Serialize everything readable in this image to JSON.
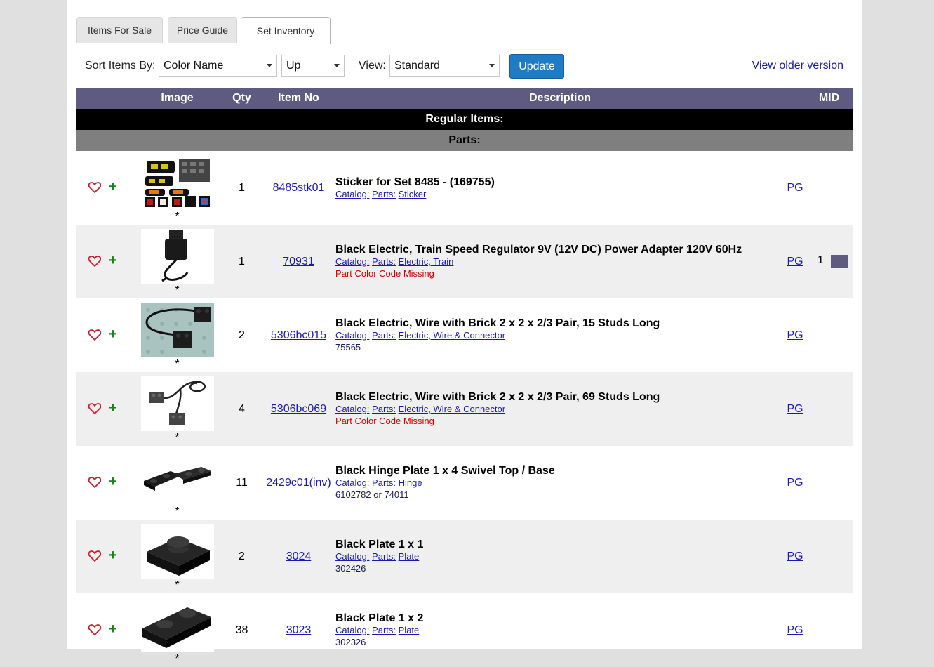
{
  "tabs": [
    "Items For Sale",
    "Price Guide",
    "Set Inventory"
  ],
  "controls": {
    "sort_label": "Sort Items By:",
    "sort_value": "Color Name",
    "direction_value": "Up",
    "view_label": "View:",
    "view_value": "Standard",
    "update_label": "Update",
    "older_link": "View older version"
  },
  "table": {
    "headers": [
      "Image",
      "Qty",
      "Item No",
      "Description",
      "MID"
    ],
    "section": "Regular Items:",
    "subsection": "Parts:",
    "star": "*",
    "pg_label": "PG",
    "catalog_label": "Catalog:",
    "parts_label": "Parts:",
    "rows": [
      {
        "qty": "1",
        "item_no": "8485stk01",
        "name": "Sticker for Set 8485 - (169755)",
        "category": "Sticker",
        "note": "",
        "alt": "",
        "mid": ""
      },
      {
        "qty": "1",
        "item_no": "70931",
        "name": "Black Electric, Train Speed Regulator 9V (12V DC) Power Adapter 120V 60Hz",
        "category": "Electric, Train",
        "note": "Part Color Code Missing",
        "alt": "",
        "mid": "1"
      },
      {
        "qty": "2",
        "item_no": "5306bc015",
        "name": "Black Electric, Wire with Brick 2 x 2 x 2/3 Pair, 15 Studs Long",
        "category": "Electric, Wire & Connector",
        "note": "",
        "alt": "75565",
        "mid": ""
      },
      {
        "qty": "4",
        "item_no": "5306bc069",
        "name": "Black Electric, Wire with Brick 2 x 2 x 2/3 Pair, 69 Studs Long",
        "category": "Electric, Wire & Connector",
        "note": "Part Color Code Missing",
        "alt": "",
        "mid": ""
      },
      {
        "qty": "11",
        "item_no": "2429c01",
        "item_suffix": "(inv)",
        "name": "Black Hinge Plate 1 x 4 Swivel Top / Base",
        "category": "Hinge",
        "note": "",
        "alt": "6102782",
        "alt_or": "or",
        "alt2": "74011",
        "mid": ""
      },
      {
        "qty": "2",
        "item_no": "3024",
        "name": "Black Plate 1 x 1",
        "category": "Plate",
        "note": "",
        "alt": "302426",
        "mid": ""
      },
      {
        "qty": "38",
        "item_no": "3023",
        "name": "Black Plate 1 x 2",
        "category": "Plate",
        "note": "",
        "alt": "302326",
        "mid": ""
      }
    ]
  }
}
